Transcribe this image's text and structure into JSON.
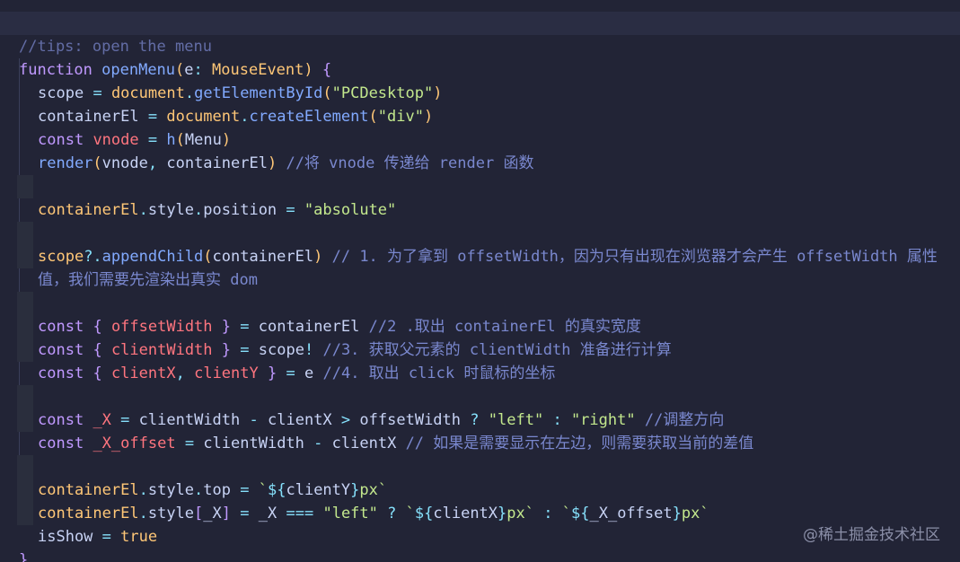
{
  "editor": {
    "lines": [
      "//tips: open the menu",
      "function openMenu(e: MouseEvent) {",
      "scope = document.getElementById(\"PCDesktop\")",
      "containerEl = document.createElement(\"div\")",
      "const vnode = h(Menu)",
      "render(vnode, containerEl) //将 vnode 传递给 render 函数",
      "",
      "containerEl.style.position = \"absolute\"",
      "",
      "scope?.appendChild(containerEl) // 1. 为了拿到 offsetWidth，因为只有出现在浏览器才会产生 offsetWidth 属性",
      "值，我们需要先渲染出真实 dom",
      "",
      "const { offsetWidth } = containerEl //2 .取出 containerEl 的真实宽度",
      "const { clientWidth } = scope! //3. 获取父元素的 clientWidth 准备进行计算",
      "const { clientX, clientY } = e //4. 取出 click 时鼠标的坐标",
      "",
      "const _X = clientWidth - clientX > offsetWidth ? \"left\" : \"right\" //调整方向",
      "const _X_offset = clientWidth - clientX // 如果是需要显示在左边，则需要获取当前的差值",
      "",
      "containerEl.style.top = `${clientY}px`",
      "containerEl.style[_X] = _X === \"left\" ? `${clientX}px` : `${_X_offset}px`",
      "isShow = true",
      "}"
    ]
  },
  "watermark": "@稀土掘金技术社区",
  "colors": {
    "background": "#222436",
    "comment": "#7a88cf",
    "keyword": "#c099ff",
    "function": "#82aaff",
    "string": "#c3e88d",
    "property": "#ffc777",
    "variable": "#ff757f",
    "operator": "#86e1fc"
  }
}
